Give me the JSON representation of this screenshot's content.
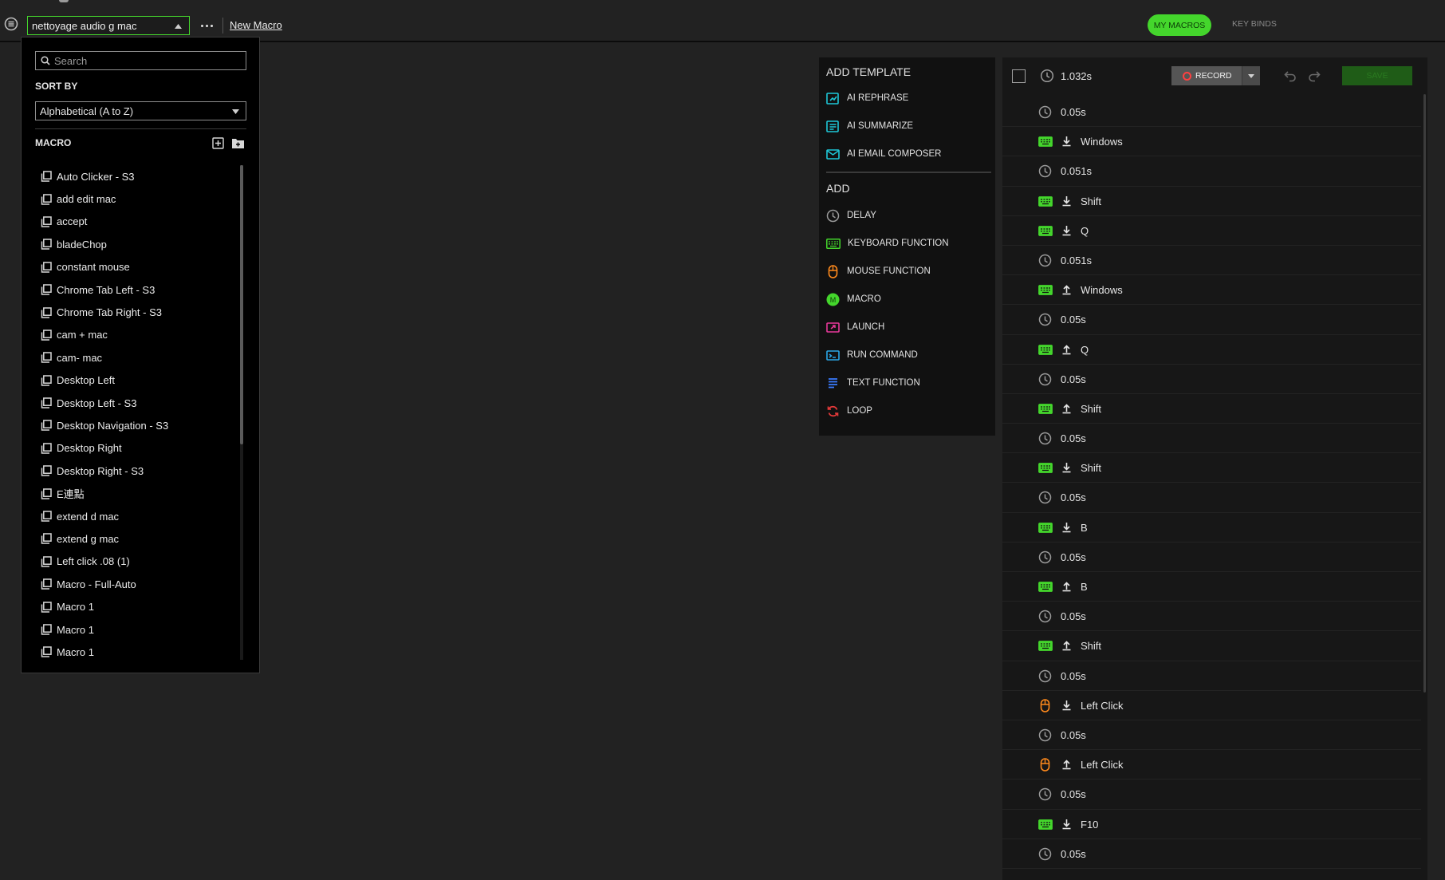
{
  "top_bar": {
    "selected_macro": "nettoyage audio g mac",
    "new_macro_label": "New Macro",
    "tabs": [
      {
        "label": "MY MACROS",
        "active": true
      },
      {
        "label": "KEY BINDS",
        "active": false
      }
    ],
    "accent_color": "#44d62c"
  },
  "dropdown": {
    "search_placeholder": "Search",
    "sort_label": "SORT BY",
    "sort_value": "Alphabetical (A to Z)",
    "macro_header": "MACRO",
    "items": [
      "Auto Clicker - S3",
      "add edit mac",
      "accept",
      "bladeChop",
      "constant mouse",
      "Chrome Tab Left - S3",
      "Chrome Tab Right - S3",
      "cam + mac",
      "cam- mac",
      "Desktop Left",
      "Desktop Left - S3",
      "Desktop Navigation - S3",
      "Desktop Right",
      "Desktop Right - S3",
      "E連點",
      "extend d mac",
      "extend g mac",
      "Left click .08 (1)",
      "Macro - Full-Auto",
      "Macro 1",
      "Macro 1",
      "Macro 1"
    ]
  },
  "add_panel": {
    "template_heading": "ADD TEMPLATE",
    "templates": [
      {
        "label": "AI REPHRASE",
        "icon": "ai-rephrase-icon",
        "color": "#1ec8d8"
      },
      {
        "label": "AI SUMMARIZE",
        "icon": "ai-summarize-icon",
        "color": "#1ec8d8"
      },
      {
        "label": "AI EMAIL COMPOSER",
        "icon": "ai-email-icon",
        "color": "#1ec8d8"
      }
    ],
    "add_heading": "ADD",
    "items": [
      {
        "label": "DELAY",
        "icon": "clock-icon",
        "color": "#9a9a9a"
      },
      {
        "label": "KEYBOARD FUNCTION",
        "icon": "keyboard-icon",
        "color": "#44d62c"
      },
      {
        "label": "MOUSE FUNCTION",
        "icon": "mouse-icon",
        "color": "#ff8a1c"
      },
      {
        "label": "MACRO",
        "icon": "macro-icon",
        "color": "#44d62c"
      },
      {
        "label": "LAUNCH",
        "icon": "launch-icon",
        "color": "#e8399a"
      },
      {
        "label": "RUN COMMAND",
        "icon": "terminal-icon",
        "color": "#2aa7e8"
      },
      {
        "label": "TEXT FUNCTION",
        "icon": "text-icon",
        "color": "#3a7bff"
      },
      {
        "label": "LOOP",
        "icon": "loop-icon",
        "color": "#e83a3a"
      }
    ]
  },
  "editor": {
    "total_time": "1.032s",
    "record_label": "RECORD",
    "save_label": "SAVE",
    "steps": [
      {
        "type": "delay",
        "label": "0.05s"
      },
      {
        "type": "key",
        "direction": "down",
        "label": "Windows"
      },
      {
        "type": "delay",
        "label": "0.051s"
      },
      {
        "type": "key",
        "direction": "down",
        "label": "Shift"
      },
      {
        "type": "key",
        "direction": "down",
        "label": "Q"
      },
      {
        "type": "delay",
        "label": "0.051s"
      },
      {
        "type": "key",
        "direction": "up",
        "label": "Windows"
      },
      {
        "type": "delay",
        "label": "0.05s"
      },
      {
        "type": "key",
        "direction": "up",
        "label": "Q"
      },
      {
        "type": "delay",
        "label": "0.05s"
      },
      {
        "type": "key",
        "direction": "up",
        "label": "Shift"
      },
      {
        "type": "delay",
        "label": "0.05s"
      },
      {
        "type": "key",
        "direction": "down",
        "label": "Shift"
      },
      {
        "type": "delay",
        "label": "0.05s"
      },
      {
        "type": "key",
        "direction": "down",
        "label": "B"
      },
      {
        "type": "delay",
        "label": "0.05s"
      },
      {
        "type": "key",
        "direction": "up",
        "label": "B"
      },
      {
        "type": "delay",
        "label": "0.05s"
      },
      {
        "type": "key",
        "direction": "up",
        "label": "Shift"
      },
      {
        "type": "delay",
        "label": "0.05s"
      },
      {
        "type": "mouse",
        "direction": "down",
        "label": "Left Click"
      },
      {
        "type": "delay",
        "label": "0.05s"
      },
      {
        "type": "mouse",
        "direction": "up",
        "label": "Left Click"
      },
      {
        "type": "delay",
        "label": "0.05s"
      },
      {
        "type": "key",
        "direction": "down",
        "label": "F10"
      },
      {
        "type": "delay",
        "label": "0.05s"
      }
    ]
  }
}
